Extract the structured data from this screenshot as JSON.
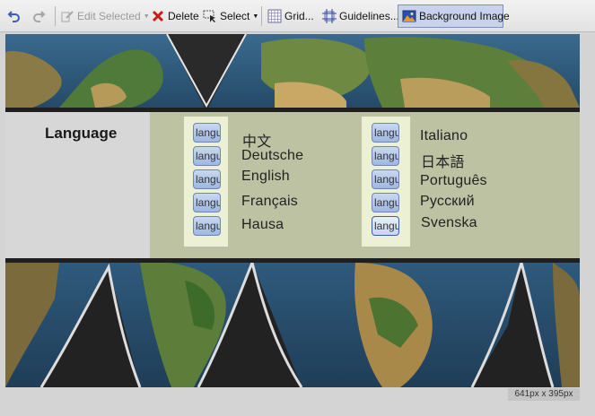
{
  "toolbar": {
    "undo_icon": "undo-icon",
    "redo_icon": "redo-icon",
    "edit_selected_label": "Edit Selected",
    "delete_label": "Delete",
    "select_label": "Select",
    "grid_label": "Grid...",
    "guidelines_label": "Guidelines...",
    "background_image_label": "Background Image",
    "colors": {
      "delete_red": "#cc1a1a",
      "active_bg": "#c9d2ec"
    }
  },
  "canvas": {
    "background_image": "world-map",
    "colors": {
      "label_cell": "#d7d7d7",
      "content_cell": "#bdc3a2",
      "icon_column": "#ecf0d4",
      "band": "#1f1f1f"
    },
    "heading": "Language",
    "buttons": {
      "text": "language",
      "left": [
        "language",
        "language",
        "language",
        "language",
        "language"
      ],
      "right": [
        "language",
        "language",
        "language",
        "language",
        "language"
      ]
    },
    "languages_left": [
      "中文",
      "Deutsche",
      "English",
      "Français",
      "Hausa"
    ],
    "languages_right": [
      "Italiano",
      "日本語",
      "Português",
      "Русский",
      "Svenska"
    ]
  },
  "status": {
    "size": "641px x 395px"
  }
}
